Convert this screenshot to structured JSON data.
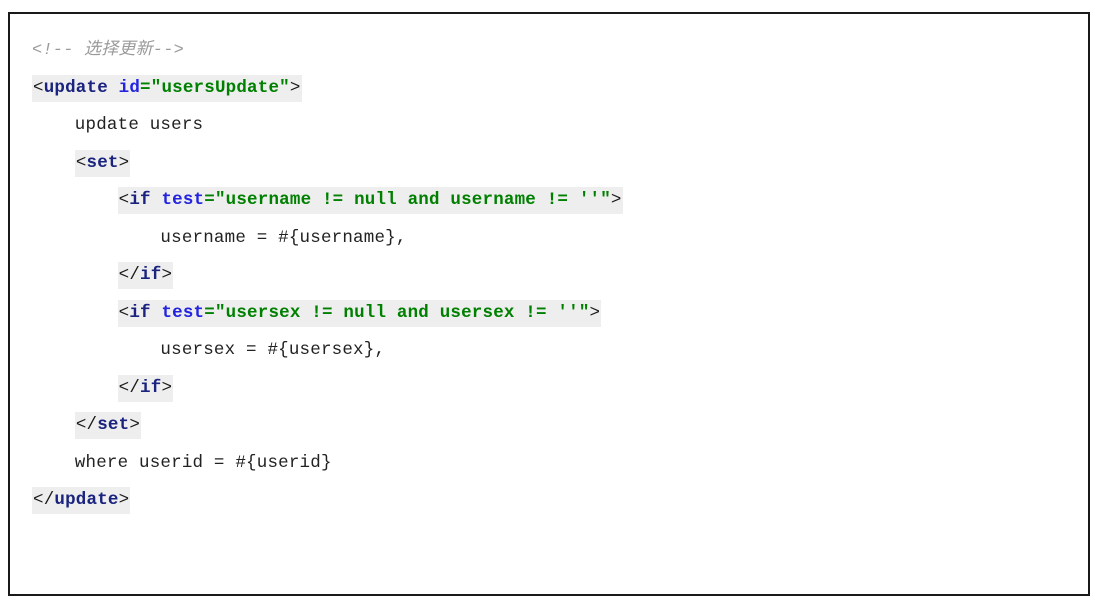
{
  "document": {
    "title": "MyBatis dynamic update mapper snippet",
    "language": "xml",
    "colors": {
      "background": "#ffffff",
      "border": "#1a1a1a",
      "highlight": "#eeeeee",
      "comment": "#9a9a9a",
      "tag_name": "#1a237e",
      "attribute_name": "#2323e0",
      "attribute_value": "#008000",
      "plain_text": "#222222"
    }
  },
  "code": {
    "line1": {
      "comment": "<!-- 选择更新-->"
    },
    "line2": {
      "open_bracket": "<",
      "tag": "update",
      "space": " ",
      "attr": "id",
      "eq_quote": "=\"",
      "value": "usersUpdate",
      "close_quote": "\"",
      "close_bracket": ">"
    },
    "line3": {
      "text": "    update users"
    },
    "line4": {
      "indent": "    ",
      "open_bracket": "<",
      "tag": "set",
      "close_bracket": ">"
    },
    "line5": {
      "indent": "        ",
      "open_bracket": "<",
      "tag": "if",
      "space": " ",
      "attr": "test",
      "eq_quote": "=\"",
      "value": "username != null and username != ''",
      "close_quote": "\"",
      "close_bracket": ">"
    },
    "line6": {
      "text": "            username = #{username},"
    },
    "line7": {
      "indent": "        ",
      "open_bracket": "</",
      "tag": "if",
      "close_bracket": ">"
    },
    "line8": {
      "indent": "        ",
      "open_bracket": "<",
      "tag": "if",
      "space": " ",
      "attr": "test",
      "eq_quote": "=\"",
      "value": "usersex != null and usersex != ''",
      "close_quote": "\"",
      "close_bracket": ">"
    },
    "line9": {
      "text": "            usersex = #{usersex},"
    },
    "line10": {
      "indent": "        ",
      "open_bracket": "</",
      "tag": "if",
      "close_bracket": ">"
    },
    "line11": {
      "indent": "    ",
      "open_bracket": "</",
      "tag": "set",
      "close_bracket": ">"
    },
    "line12": {
      "text": "    where userid = #{userid}"
    },
    "line13": {
      "open_bracket": "</",
      "tag": "update",
      "close_bracket": ">"
    }
  }
}
